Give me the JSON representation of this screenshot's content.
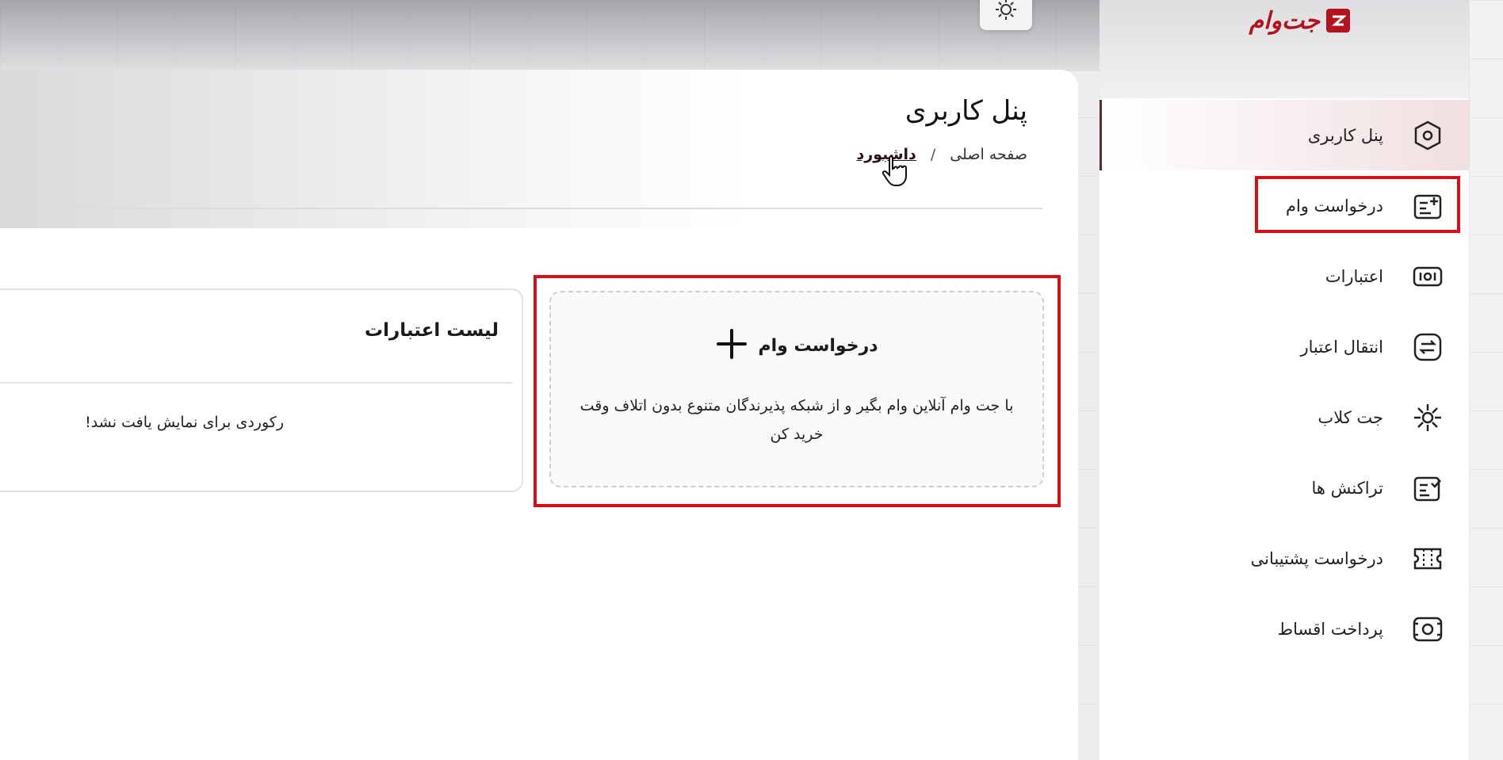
{
  "brand": {
    "logo_text": "جت‌وام",
    "accent": "#b3121f"
  },
  "header": {
    "page_title": "پنل کاربری",
    "breadcrumb": {
      "home": "صفحه اصلی",
      "separator": "/",
      "current": "داشبورد"
    }
  },
  "sidebar": {
    "items": [
      {
        "label": "پنل کاربری",
        "icon": "hexagon-icon",
        "active": true
      },
      {
        "label": "درخواست وام",
        "icon": "loan-request-icon",
        "active": false
      },
      {
        "label": "اعتبارات",
        "icon": "credit-icon",
        "active": false
      },
      {
        "label": "انتقال اعتبار",
        "icon": "transfer-icon",
        "active": false
      },
      {
        "label": "جت کلاب",
        "icon": "club-icon",
        "active": false
      },
      {
        "label": "تراکنش ها",
        "icon": "transactions-icon",
        "active": false
      },
      {
        "label": "درخواست پشتیبانی",
        "icon": "ticket-icon",
        "active": false
      },
      {
        "label": "پرداخت اقساط",
        "icon": "installment-icon",
        "active": false
      }
    ]
  },
  "loan_card": {
    "title": "درخواست وام",
    "description": "با جت وام آنلاین وام بگیر و از شبکه پذیرندگان متنوع بدون اتلاف وقت خرید کن"
  },
  "credits_list": {
    "title": "لیست اعتبارات",
    "empty_message": "رکوردی برای نمایش یافت نشد!"
  },
  "colors": {
    "highlight": "#d40f15",
    "active_bg": "#f1dfe1"
  }
}
